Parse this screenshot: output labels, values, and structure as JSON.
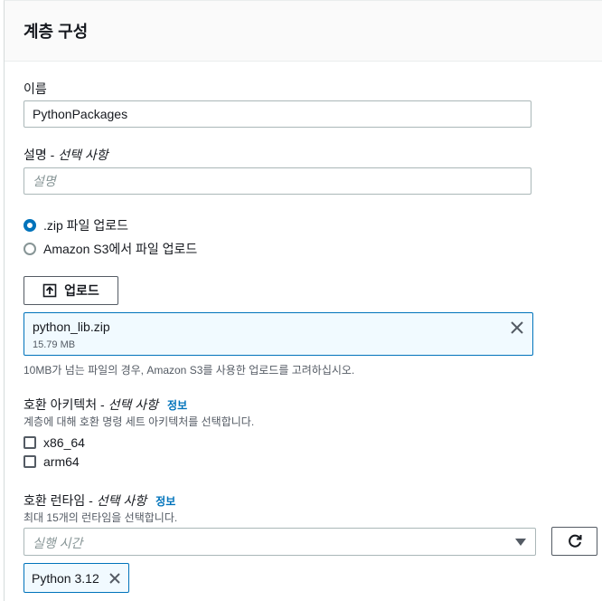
{
  "panel": {
    "title": "계층 구성"
  },
  "name_field": {
    "label": "이름",
    "value": "PythonPackages"
  },
  "description_field": {
    "label": "설명",
    "optional_suffix": "선택 사항",
    "separator": " - ",
    "placeholder": "설명"
  },
  "upload_options": [
    {
      "label": ".zip 파일 업로드",
      "selected": true
    },
    {
      "label": "Amazon S3에서 파일 업로드",
      "selected": false
    }
  ],
  "upload_button": {
    "label": "업로드",
    "icon": "upload-icon"
  },
  "uploaded_file": {
    "name": "python_lib.zip",
    "size": "15.79 MB",
    "remove_icon": "close-icon"
  },
  "upload_hint": "10MB가 넘는 파일의 경우, Amazon S3를 사용한 업로드를 고려하십시오.",
  "architectures": {
    "label": "호환 아키텍처",
    "optional_suffix": "선택 사항",
    "separator": " - ",
    "info": "정보",
    "description": "계층에 대해 호환 명령 세트 아키텍처를 선택합니다.",
    "options": [
      {
        "label": "x86_64",
        "checked": false
      },
      {
        "label": "arm64",
        "checked": false
      }
    ]
  },
  "runtimes": {
    "label": "호환 런타임",
    "optional_suffix": "선택 사항",
    "separator": " - ",
    "info": "정보",
    "description": "최대 15개의 런타임을 선택합니다.",
    "placeholder": "실행 시간",
    "refresh_icon": "refresh-icon",
    "selected": [
      {
        "label": "Python 3.12"
      }
    ]
  },
  "colors": {
    "accent": "#0073bb",
    "token_bg": "#f1faff",
    "border": "#aab7b8"
  }
}
